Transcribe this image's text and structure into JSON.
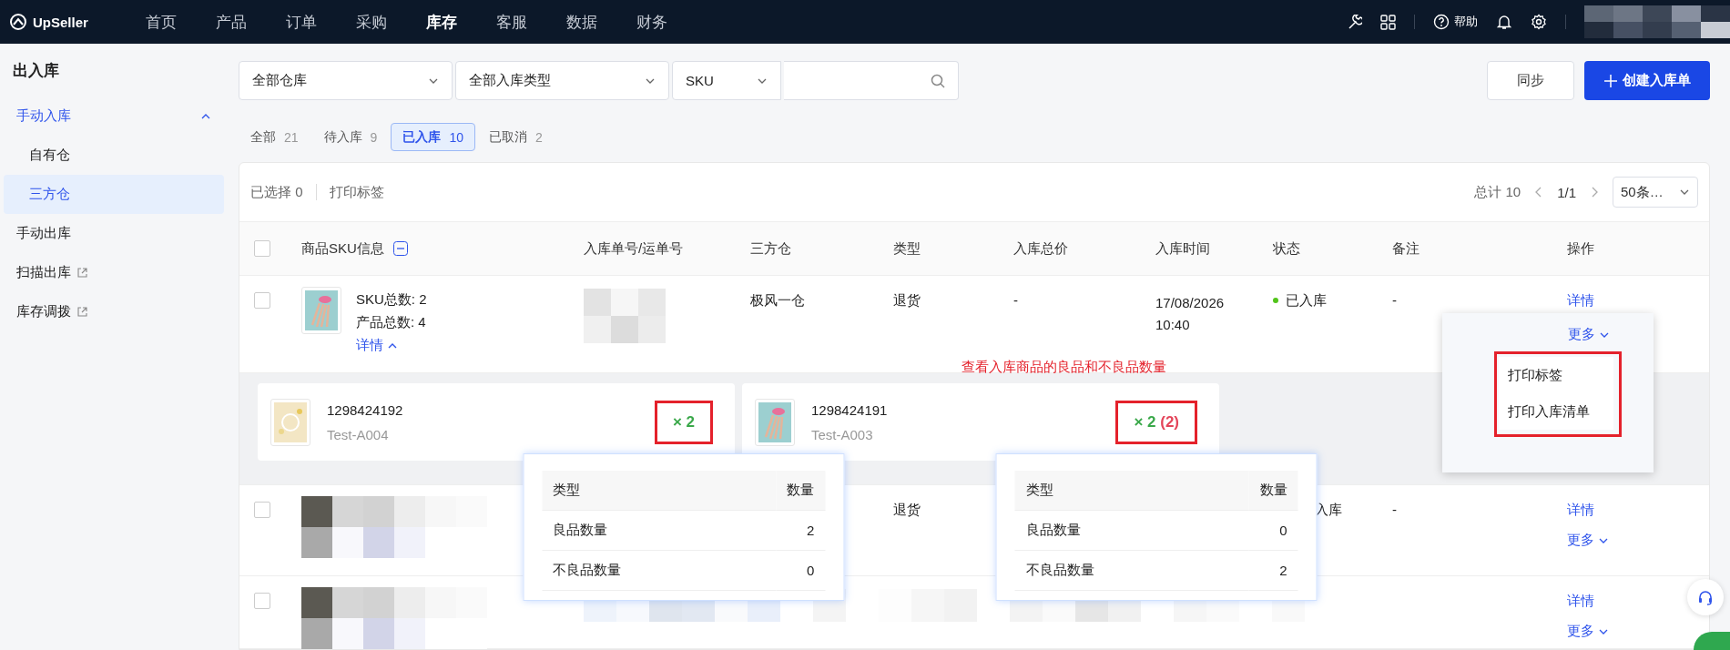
{
  "top_nav": {
    "logo": "UpSeller",
    "items": [
      {
        "label": "首页",
        "selected": false
      },
      {
        "label": "产品",
        "selected": false
      },
      {
        "label": "订单",
        "selected": false
      },
      {
        "label": "采购",
        "selected": false
      },
      {
        "label": "库存",
        "selected": true
      },
      {
        "label": "客服",
        "selected": false
      },
      {
        "label": "数据",
        "selected": false
      },
      {
        "label": "财务",
        "selected": false
      }
    ],
    "help": "帮助"
  },
  "sidebar": {
    "title": "出入库",
    "items": [
      {
        "label": "手动入库",
        "selected": false,
        "expanded": true,
        "external": false,
        "children": [
          {
            "label": "自有仓",
            "selected": false
          },
          {
            "label": "三方仓",
            "selected": true
          }
        ]
      },
      {
        "label": "手动出库",
        "selected": false,
        "external": false
      },
      {
        "label": "扫描出库",
        "selected": false,
        "external": true
      },
      {
        "label": "库存调拨",
        "selected": false,
        "external": true
      }
    ]
  },
  "filters": {
    "warehouse": "全部仓库",
    "inbound_type": "全部入库类型",
    "search_by": "SKU"
  },
  "actions": {
    "sync": "同步",
    "create": "创建入库单"
  },
  "status_tabs": [
    {
      "label": "全部",
      "count": "21",
      "selected": false
    },
    {
      "label": "待入库",
      "count": "9",
      "selected": false
    },
    {
      "label": "已入库",
      "count": "10",
      "selected": true
    },
    {
      "label": "已取消",
      "count": "2",
      "selected": false
    }
  ],
  "toolbar": {
    "selected_label": "已选择",
    "selected_count": "0",
    "print_label": "打印标签",
    "total": "总计 10",
    "page": "1/1",
    "page_size": "50条…"
  },
  "table": {
    "columns": [
      "商品SKU信息",
      "入库单号/运单号",
      "三方仓",
      "类型",
      "入库总价",
      "入库时间",
      "状态",
      "备注",
      "操作"
    ],
    "header_checked": false,
    "rows": [
      {
        "checked": false,
        "sku_total": "SKU总数: 2",
        "product_total": "产品总数: 4",
        "detail_toggle": "详情",
        "expanded": true,
        "warehouse": "极风一仓",
        "type": "退货",
        "price": "-",
        "time": "17/08/2026 10:40",
        "status": "已入库",
        "color": "#52c41a",
        "remark": "-",
        "actions": [
          "详情"
        ],
        "items": [
          {
            "sku": "1298424192",
            "code": "Test-A004",
            "quantity": "× 2",
            "breakdown": {
              "columns": [
                "类型",
                "数量"
              ],
              "rows": [
                [
                  "良品数量",
                  "2"
                ],
                [
                  "不良品数量",
                  "0"
                ]
              ]
            }
          },
          {
            "sku": "1298424191",
            "code": "Test-A003",
            "quantity": "× 2",
            "defective": "(2)",
            "breakdown": {
              "columns": [
                "类型",
                "数量"
              ],
              "rows": [
                [
                  "良品数量",
                  "0"
                ],
                [
                  "不良品数量",
                  "2"
                ]
              ]
            }
          }
        ]
      },
      {
        "checked": false,
        "type": "退货",
        "status": "入库",
        "remark": "-",
        "actions": [
          "详情",
          "更多"
        ]
      },
      {
        "checked": false,
        "actions": [
          "详情",
          "更多"
        ]
      }
    ]
  },
  "annotation": "查看入库商品的良品和不良品数量",
  "more_menu": {
    "trigger": "更多",
    "items": [
      "打印标签",
      "打印入库清单"
    ]
  }
}
